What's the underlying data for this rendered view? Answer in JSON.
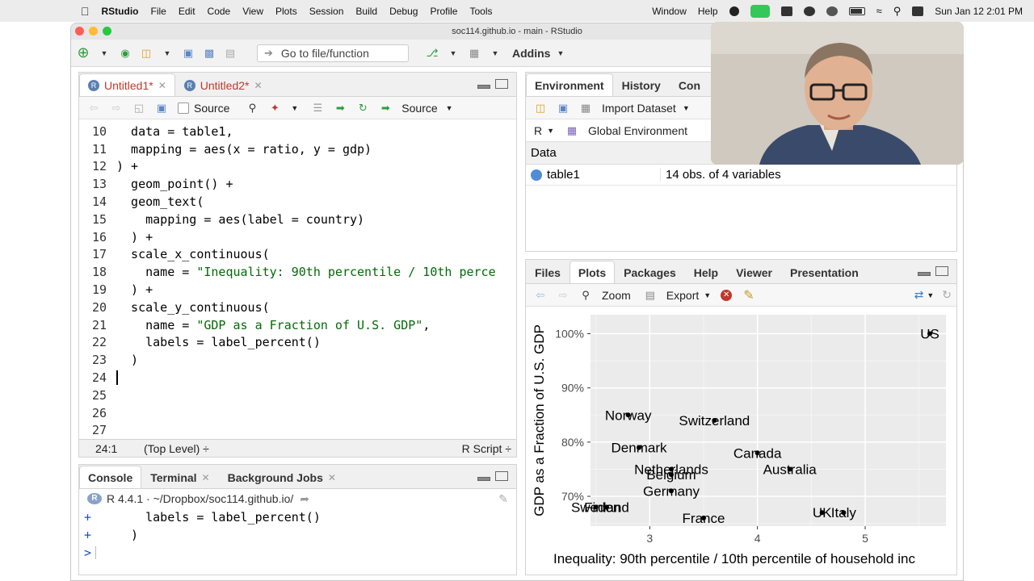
{
  "menubar": {
    "app": "RStudio",
    "items": [
      "File",
      "Edit",
      "Code",
      "View",
      "Plots",
      "Session",
      "Build",
      "Debug",
      "Profile",
      "Tools"
    ],
    "right_items": [
      "Window",
      "Help"
    ],
    "clock": "Sun Jan 12  2:01 PM"
  },
  "window": {
    "title": "soc114.github.io - main - RStudio"
  },
  "toolbar": {
    "goto_placeholder": "Go to file/function",
    "addins": "Addins"
  },
  "editor": {
    "tabs": [
      {
        "label": "Untitled1*"
      },
      {
        "label": "Untitled2*"
      }
    ],
    "source_on_save": "Source",
    "source_button": "Source",
    "lines": [
      {
        "n": "10",
        "t": "  data = table1,"
      },
      {
        "n": "11",
        "t": "  mapping = aes(x = ratio, y = gdp)"
      },
      {
        "n": "12",
        "t": ") +"
      },
      {
        "n": "13",
        "t": "  geom_point() +"
      },
      {
        "n": "14",
        "t": "  geom_text("
      },
      {
        "n": "15",
        "t": "    mapping = aes(label = country)"
      },
      {
        "n": "16",
        "t": "  ) +"
      },
      {
        "n": "17",
        "t": "  scale_x_continuous("
      },
      {
        "n": "18",
        "t": "    name = ",
        "s": "\"Inequality: 90th percentile / 10th perce"
      },
      {
        "n": "19",
        "t": "  ) +"
      },
      {
        "n": "20",
        "t": "  scale_y_continuous("
      },
      {
        "n": "21",
        "t": "    name = ",
        "s": "\"GDP as a Fraction of U.S. GDP\"",
        "after": ","
      },
      {
        "n": "22",
        "t": "    labels = label_percent()"
      },
      {
        "n": "23",
        "t": "  )"
      },
      {
        "n": "24",
        "t": ""
      },
      {
        "n": "25",
        "t": ""
      },
      {
        "n": "26",
        "t": ""
      },
      {
        "n": "27",
        "t": ""
      }
    ],
    "status_pos": "24:1",
    "status_scope": "(Top Level) ÷",
    "status_type": "R Script ÷"
  },
  "console": {
    "tabs": [
      "Console",
      "Terminal",
      "Background Jobs"
    ],
    "header": "R 4.4.1 · ~/Dropbox/soc114.github.io/",
    "lines": [
      {
        "p": "+",
        "t": "    labels = label_percent()"
      },
      {
        "p": "+",
        "t": "  )"
      },
      {
        "p": ">",
        "t": ""
      }
    ]
  },
  "environment": {
    "tabs": [
      "Environment",
      "History",
      "Con"
    ],
    "import": "Import Dataset",
    "lang": "R",
    "scope": "Global Environment",
    "section": "Data",
    "rows": [
      {
        "name": "table1",
        "value": "14 obs. of 4 variables"
      }
    ]
  },
  "files_pane": {
    "tabs": [
      "Files",
      "Plots",
      "Packages",
      "Help",
      "Viewer",
      "Presentation"
    ],
    "zoom": "Zoom",
    "export": "Export"
  },
  "chart_data": {
    "type": "scatter",
    "xlabel": "Inequality: 90th percentile / 10th percentile of household inc",
    "ylabel": "GDP as a Fraction of U.S. GDP",
    "xlim": [
      2.45,
      5.75
    ],
    "ylim": [
      0.645,
      1.035
    ],
    "x_ticks": [
      3,
      4,
      5
    ],
    "y_ticks": [
      0.7,
      0.8,
      0.9,
      1.0
    ],
    "y_tick_labels": [
      "70%",
      "80%",
      "90%",
      "100%"
    ],
    "points": [
      {
        "label": "US",
        "x": 5.6,
        "y": 1.0
      },
      {
        "label": "Norway",
        "x": 2.8,
        "y": 0.85
      },
      {
        "label": "Switzerland",
        "x": 3.6,
        "y": 0.84
      },
      {
        "label": "Denmark",
        "x": 2.9,
        "y": 0.79
      },
      {
        "label": "Canada",
        "x": 4.0,
        "y": 0.78
      },
      {
        "label": "Netherlands",
        "x": 3.2,
        "y": 0.75
      },
      {
        "label": "Australia",
        "x": 4.3,
        "y": 0.75
      },
      {
        "label": "Belgium",
        "x": 3.2,
        "y": 0.74
      },
      {
        "label": "Germany",
        "x": 3.2,
        "y": 0.71
      },
      {
        "label": "Finland",
        "x": 2.6,
        "y": 0.68
      },
      {
        "label": "Sweden",
        "x": 2.5,
        "y": 0.68
      },
      {
        "label": "UK",
        "x": 4.6,
        "y": 0.67
      },
      {
        "label": "Italy",
        "x": 4.8,
        "y": 0.67
      },
      {
        "label": "France",
        "x": 3.5,
        "y": 0.66
      }
    ]
  }
}
